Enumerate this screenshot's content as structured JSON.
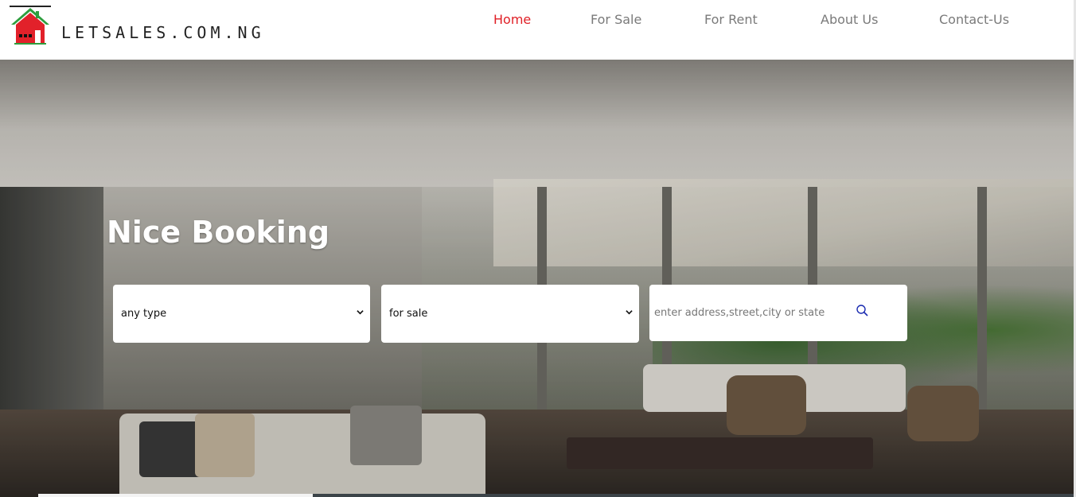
{
  "brand": {
    "name": "LETSALES.COM.NG"
  },
  "nav": {
    "items": [
      {
        "label": "Home",
        "active": true
      },
      {
        "label": "For Sale",
        "active": false
      },
      {
        "label": "For Rent",
        "active": false
      },
      {
        "label": "About Us",
        "active": false
      },
      {
        "label": "Contact-Us",
        "active": false
      }
    ]
  },
  "hero": {
    "title": "Nice Booking",
    "type_select": {
      "selected": "any type"
    },
    "status_select": {
      "selected": "for sale"
    },
    "search": {
      "placeholder": "enter address,street,city or state",
      "value": ""
    }
  },
  "icons": {
    "logo": "house-logo-icon",
    "search": "search-icon",
    "dropdown": "chevron-down-icon"
  },
  "colors": {
    "active_nav": "#e01f26",
    "nav": "#7a7a7a",
    "logo_roof": "#2e9e3e",
    "logo_house": "#e2212a",
    "search_icon": "#1a2bb0"
  }
}
